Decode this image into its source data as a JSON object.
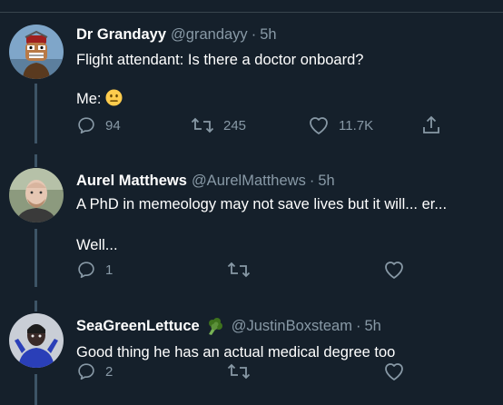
{
  "tweets": [
    {
      "display_name": "Dr Grandayy",
      "handle": "@grandayy",
      "separator": "·",
      "time": "5h",
      "lines": [
        "Flight attendant: Is there a doctor onboard?",
        "",
        "Me:"
      ],
      "emoji": "neutral-face",
      "replies": "94",
      "retweets": "245",
      "likes": "11.7K"
    },
    {
      "display_name": "Aurel Matthews",
      "handle": "@AurelMatthews",
      "separator": "·",
      "time": "5h",
      "lines": [
        "A PhD in memeology may not save lives but it will... er...",
        "",
        "Well..."
      ],
      "replies": "1",
      "retweets": "",
      "likes": ""
    },
    {
      "display_name": "SeaGreenLettuce",
      "name_emoji": "broccoli",
      "handle": "@JustinBoxsteam",
      "separator": "·",
      "time": "5h",
      "lines": [
        "Good thing he has an actual medical degree too"
      ],
      "replies": "2",
      "retweets": "",
      "likes": ""
    }
  ],
  "colors": {
    "background": "#15202b",
    "secondary_text": "#8899a6",
    "thread_line": "#3d5466",
    "divider": "#38444d"
  }
}
